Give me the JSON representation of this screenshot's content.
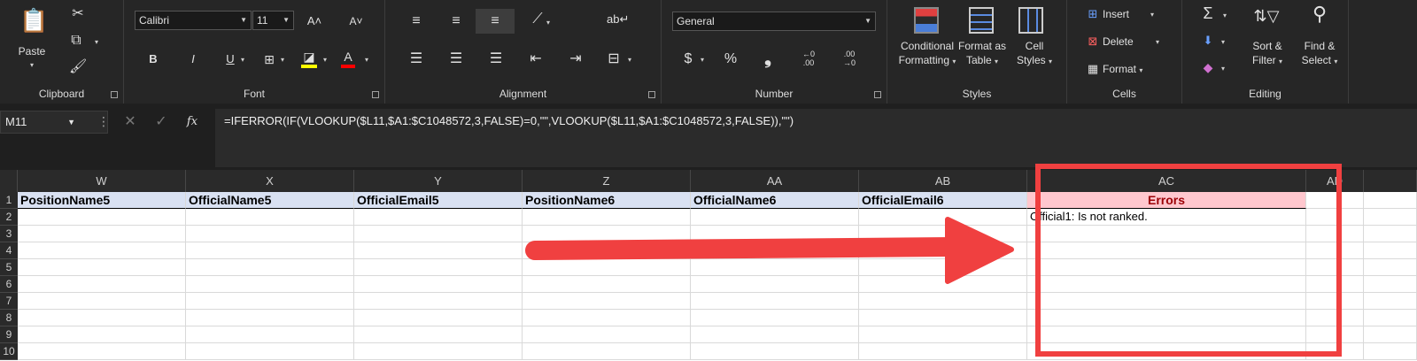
{
  "ribbon": {
    "clipboard": {
      "label": "Clipboard",
      "paste": "Paste"
    },
    "font": {
      "label": "Font",
      "name": "Calibri",
      "size": "11",
      "bold": "B",
      "italic": "I",
      "underline": "U",
      "font_color_glyph": "A",
      "grow": "A",
      "shrink": "A"
    },
    "alignment": {
      "label": "Alignment"
    },
    "number": {
      "label": "Number",
      "format": "General",
      "currency": "$",
      "percent": "%",
      "comma": "❟",
      "inc_dec": ".00",
      "dec_dec": ".00"
    },
    "styles": {
      "label": "Styles",
      "conditional": "Conditional",
      "conditional2": "Formatting",
      "format_as": "Format as",
      "format_as2": "Table",
      "cell": "Cell",
      "cell2": "Styles"
    },
    "cells": {
      "label": "Cells",
      "insert": "Insert",
      "delete": "Delete",
      "format": "Format"
    },
    "editing": {
      "label": "Editing",
      "sort": "Sort &",
      "sort2": "Filter",
      "find": "Find &",
      "find2": "Select"
    }
  },
  "formula_bar": {
    "name_box": "M11",
    "fx": "fx",
    "formula": "=IFERROR(IF(VLOOKUP($L11,$A1:$C1048572,3,FALSE)=0,\"\",VLOOKUP($L11,$A1:$C1048572,3,FALSE)),\"\")"
  },
  "grid": {
    "columns": [
      "W",
      "X",
      "Y",
      "Z",
      "AA",
      "AB",
      "AC",
      "AD"
    ],
    "rows": [
      "1",
      "2",
      "3",
      "4",
      "5",
      "6",
      "7",
      "8",
      "9",
      "10"
    ],
    "headers": [
      "PositionName5",
      "OfficialName5",
      "OfficialEmail5",
      "PositionName6",
      "OfficialName6",
      "OfficialEmail6",
      "Errors"
    ],
    "ac2": "Official1: Is not ranked."
  },
  "colors": {
    "annotation": "#f04040",
    "error_fill": "#ffc7ce",
    "error_text": "#9c0006",
    "header_fill": "#d9e1f2"
  }
}
